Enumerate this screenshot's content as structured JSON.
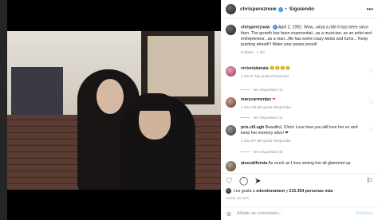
{
  "header": {
    "username": "chrispereznow",
    "follow_label": "Siguiendo",
    "more_icon": "more-icon"
  },
  "caption": {
    "username": "chrispereznow",
    "text": "April 2, 1992. Wow...what a ride it has been since then. The growth has been exponential...as a musician, as an artist and entrepreneur...as a man...life has some crazy twists and turns... Keep pushing ahead!!! Make your peeps proud!",
    "meta": "Editado · 1 día"
  },
  "comments": [
    {
      "username": "victorialamala",
      "text": "🥺🥺🥺🥺",
      "meta": "1 día   97 Me gusta   Responder",
      "replies": "Ver respuestas (1)"
    },
    {
      "username": "marycarmenlpz",
      "text": "❤",
      "meta": "1 día   135 Me gusta   Responder",
      "replies": "Ver respuestas (1)"
    },
    {
      "username": "pris.cill.ugh",
      "text": "Beautiful, Chris! Love how you still love her so and keep her memory alive! ❤",
      "meta": "1 día   337 Me gusta   Responder",
      "replies": "Ver respuestas (8)"
    },
    {
      "username": "aleecalifornia",
      "text": "As much as I love seeing her all glammed up",
      "meta": "",
      "replies": ""
    }
  ],
  "likes": {
    "prefix": "Les gusta a",
    "user": "edendorantest",
    "middle": "y",
    "count": "215.354 personas más"
  },
  "date": "HACE UN DÍA",
  "add_comment": {
    "placeholder": "Añade un comentario...",
    "publish_label": "Publicar"
  },
  "colors": {
    "accent": "#3897f0",
    "heart": "#ed4956",
    "publish_disabled": "#b2dffc"
  }
}
